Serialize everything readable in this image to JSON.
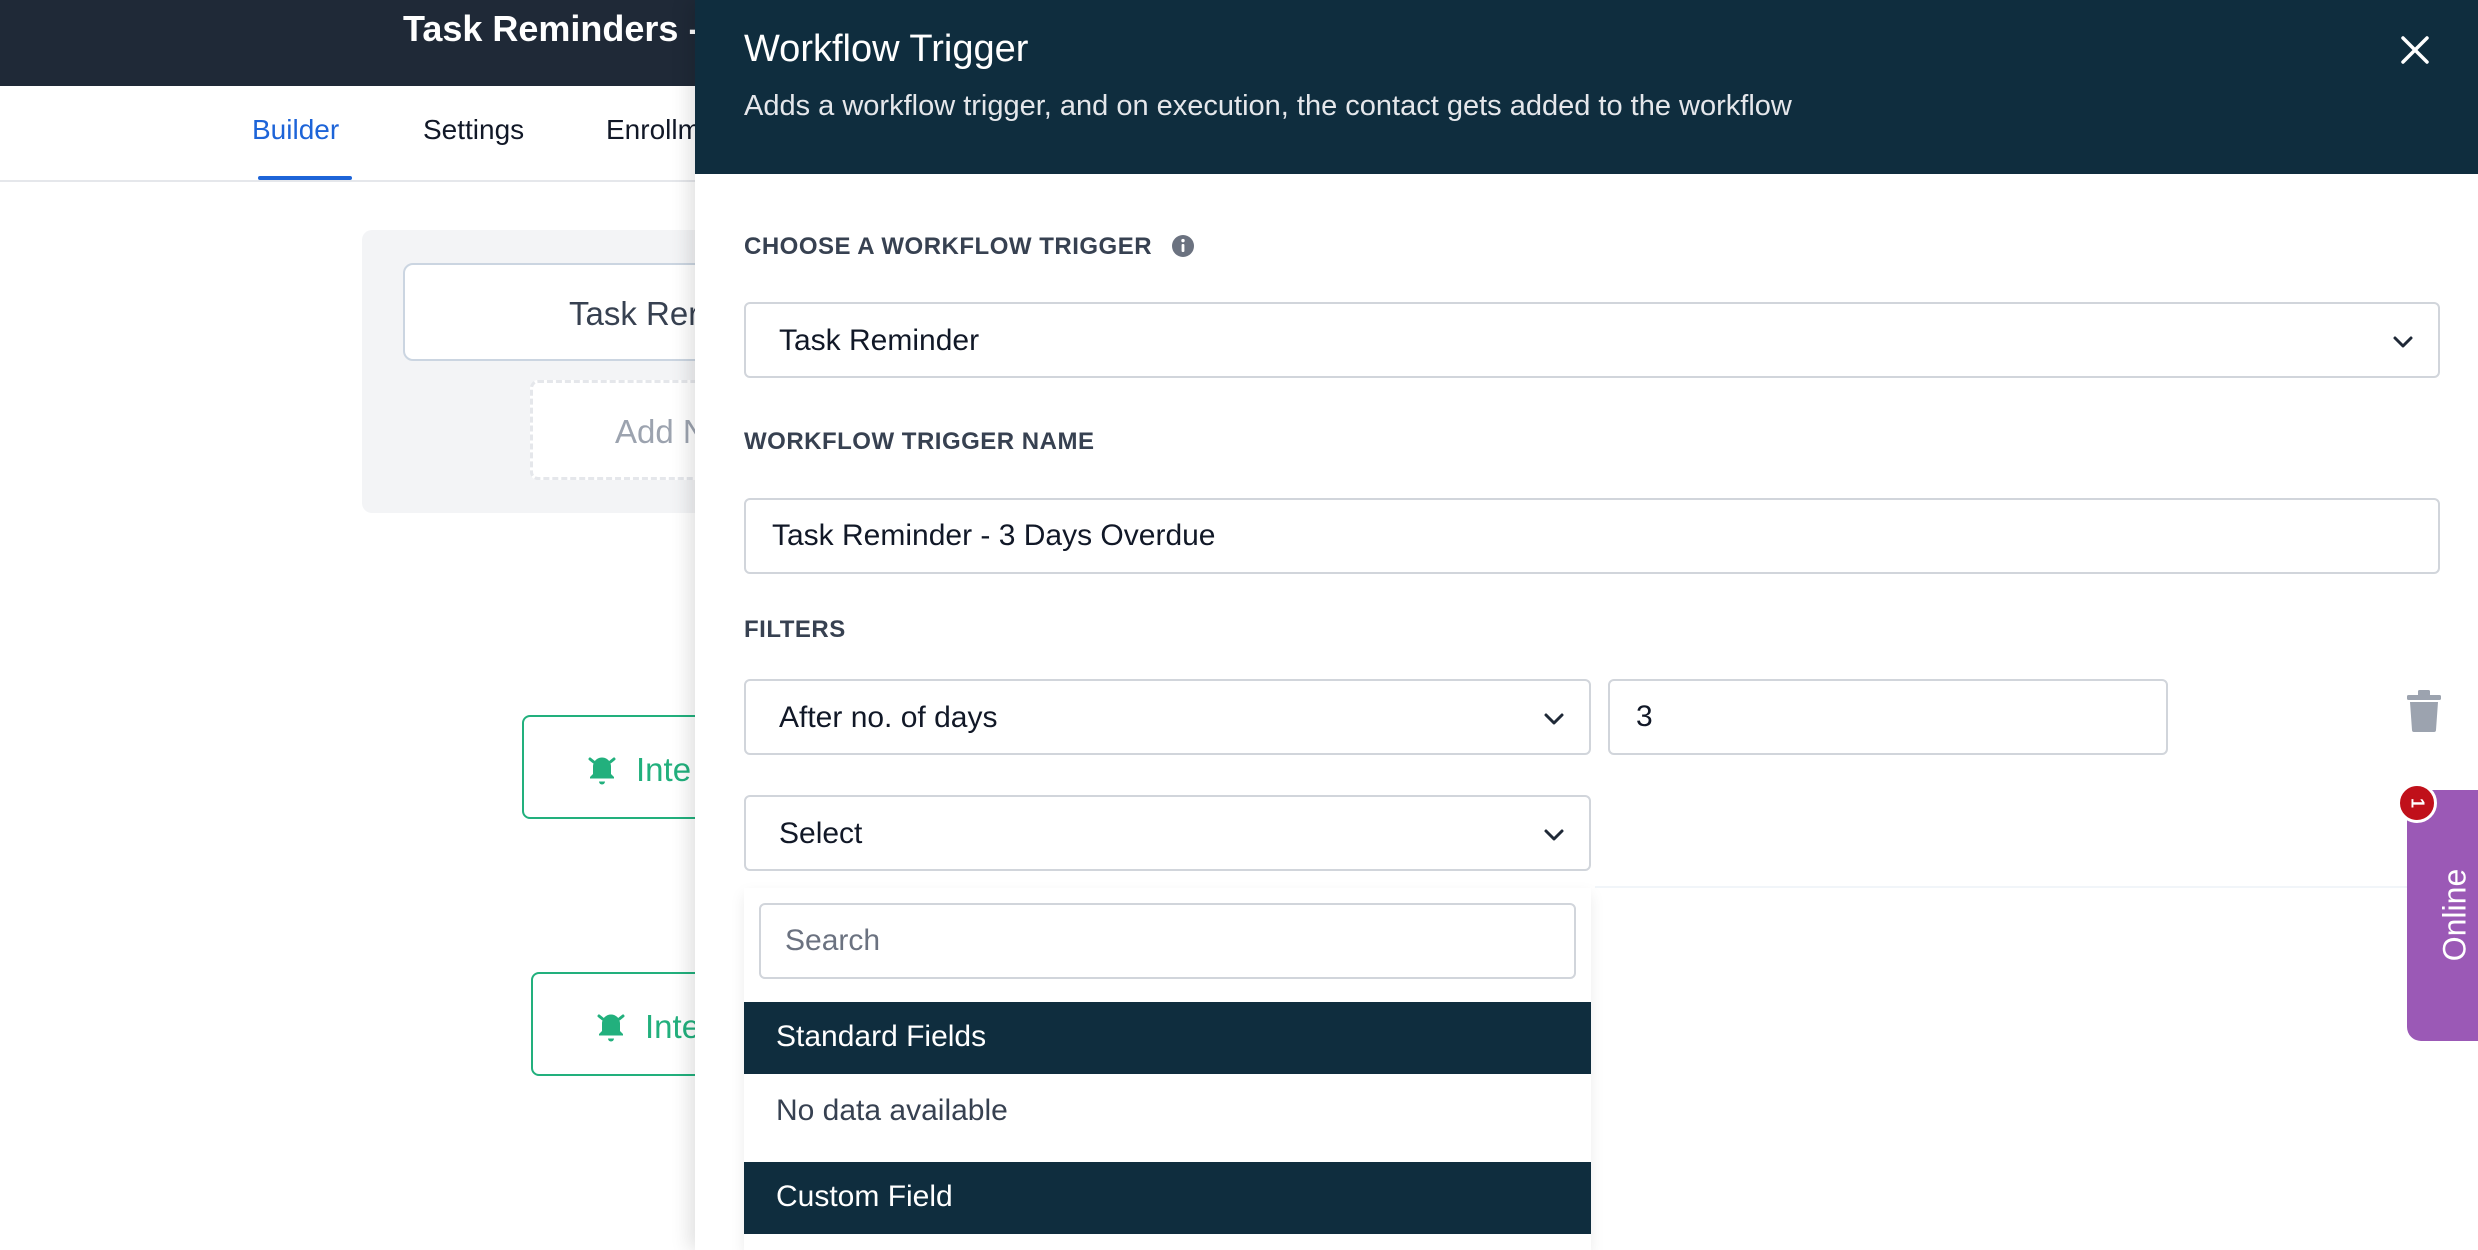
{
  "background": {
    "title": "Task Reminders -",
    "tabs": [
      {
        "label": "Builder"
      },
      {
        "label": "Settings"
      },
      {
        "label": "Enrollm"
      }
    ],
    "trigger_card_label": "Task Rer",
    "add_new_label": "Add N",
    "actions": [
      {
        "label": "Inte"
      },
      {
        "label": "Inte"
      }
    ],
    "accent_color": "#1d64d8",
    "action_color": "#22b07d"
  },
  "drawer": {
    "title": "Workflow Trigger",
    "subtitle": "Adds a workflow trigger, and on execution, the contact gets added to the workflow",
    "header_color": "#0f2d3e",
    "trigger_label": "CHOOSE A WORKFLOW TRIGGER",
    "trigger_value": "Task Reminder",
    "name_label": "WORKFLOW TRIGGER NAME",
    "name_value": "Task Reminder - 3 Days Overdue",
    "filters_label": "FILTERS",
    "filters": [
      {
        "field": "After no. of days",
        "value": "3"
      }
    ],
    "filter_select_value": "Select",
    "dropdown": {
      "search_placeholder": "Search",
      "groups": [
        {
          "label": "Standard Fields",
          "empty_text": "No data available"
        },
        {
          "label": "Custom Field"
        }
      ]
    }
  },
  "chat_widget": {
    "label": "Online",
    "badge_count": "1",
    "color": "#9b59b6"
  }
}
